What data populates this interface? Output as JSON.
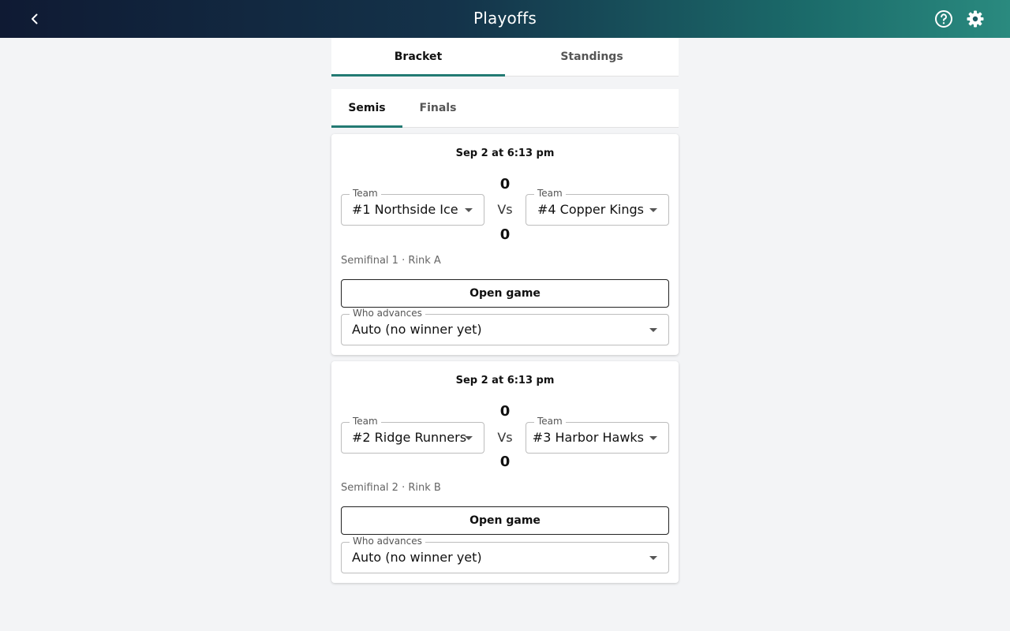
{
  "header": {
    "title": "Playoffs",
    "back_icon": "chevron-left-icon",
    "help_icon": "help-circle-icon",
    "settings_icon": "gear-icon"
  },
  "main_tabs": [
    {
      "label": "Bracket",
      "active": true
    },
    {
      "label": "Standings",
      "active": false
    }
  ],
  "round_tabs": [
    {
      "label": "Semis",
      "active": true
    },
    {
      "label": "Finals",
      "active": false
    }
  ],
  "games": [
    {
      "date": "Sep 2 at 6:13 pm",
      "team_label": "Team",
      "home_team": "#1 Northside Ice",
      "away_team": "#4 Copper Kings",
      "home_score": "0",
      "away_score": "0",
      "vs": "Vs",
      "meta": "Semifinal 1 · Rink A",
      "open_button": "Open game",
      "advance_label": "Who advances",
      "advance_value": "Auto (no winner yet)"
    },
    {
      "date": "Sep 2 at 6:13 pm",
      "team_label": "Team",
      "home_team": "#2 Ridge Runners",
      "away_team": "#3 Harbor Hawks",
      "home_score": "0",
      "away_score": "0",
      "vs": "Vs",
      "meta": "Semifinal 2 · Rink B",
      "open_button": "Open game",
      "advance_label": "Who advances",
      "advance_value": "Auto (no winner yet)"
    }
  ],
  "colors": {
    "accent": "#237a73",
    "header_start": "#0f1a33",
    "header_end": "#2a8a7f",
    "background": "#f3f4f6"
  }
}
